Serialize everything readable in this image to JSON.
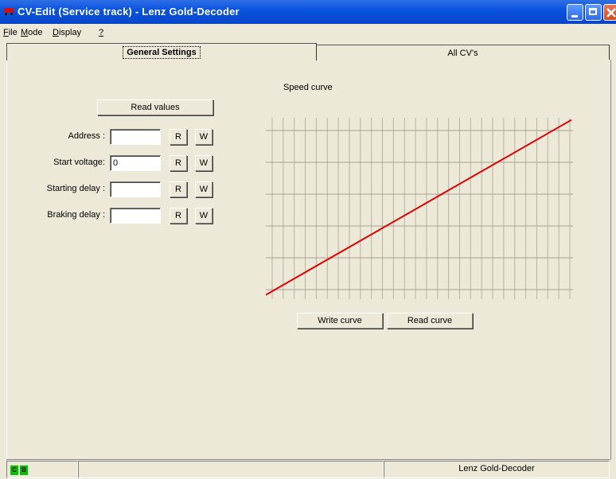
{
  "window": {
    "title": "CV-Edit (Service track) - Lenz Gold-Decoder"
  },
  "menu": [
    {
      "label": "File",
      "key": "F"
    },
    {
      "label": "Mode",
      "key": "M"
    },
    {
      "label": "Display",
      "key": "D"
    },
    {
      "label": "?",
      "key": "?"
    }
  ],
  "tabs": {
    "general": "General Settings",
    "all_cvs": "All CV's"
  },
  "settings": {
    "read_values_label": "Read values",
    "fields": [
      {
        "label": "Address :",
        "value": ""
      },
      {
        "label": "Start voltage:",
        "value": "0"
      },
      {
        "label": "Starting delay :",
        "value": ""
      },
      {
        "label": "Braking delay :",
        "value": ""
      }
    ],
    "read_button": "R",
    "write_button": "W"
  },
  "speed_curve": {
    "title": "Speed curve",
    "write_label": "Write curve",
    "read_label": "Read curve"
  },
  "chart_data": {
    "type": "line",
    "title": "Speed curve",
    "x": [
      1,
      28
    ],
    "xlim": [
      1,
      28
    ],
    "ylim": [
      0,
      255
    ],
    "series": [
      {
        "values": [
          6,
          252
        ],
        "color": "#e00000"
      }
    ],
    "grid": true
  },
  "status": {
    "led_c": "C",
    "led_b": "B",
    "led_color": "#00c000",
    "device": "Lenz Gold-Decoder"
  },
  "colors": {
    "titlebar": "#0a54e0",
    "curve": "#e00000"
  }
}
